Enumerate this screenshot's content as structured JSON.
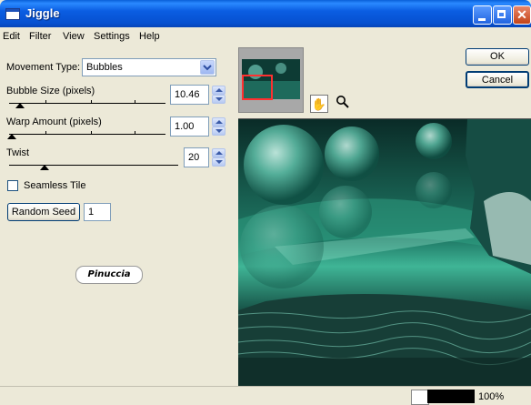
{
  "window": {
    "title": "Jiggle"
  },
  "menu": [
    "Edit",
    "Filter",
    "View",
    "Settings",
    "Help"
  ],
  "controls": {
    "movement_type": {
      "label": "Movement Type:",
      "value": "Bubbles"
    },
    "bubble_size": {
      "label": "Bubble Size (pixels)",
      "value": "10.46",
      "level": 0.05
    },
    "warp_amount": {
      "label": "Warp Amount (pixels)",
      "value": "1.00",
      "level": 0.0
    },
    "twist": {
      "label": "Twist",
      "value": "20",
      "level": 0.2
    },
    "seamless_tile": {
      "label": "Seamless Tile",
      "checked": false
    },
    "random_seed": {
      "label": "Random Seed",
      "value": "1"
    }
  },
  "logo": "Pinuccia",
  "buttons": {
    "ok": "OK",
    "cancel": "Cancel"
  },
  "tools": {
    "hand": "hand-tool-icon",
    "zoom": "magnifier-icon"
  },
  "status": {
    "zoom": "100%"
  },
  "colors": {
    "titlebar": "#0b5ee2",
    "background": "#ece9d8",
    "preview_teal": "#1b6b5a"
  }
}
